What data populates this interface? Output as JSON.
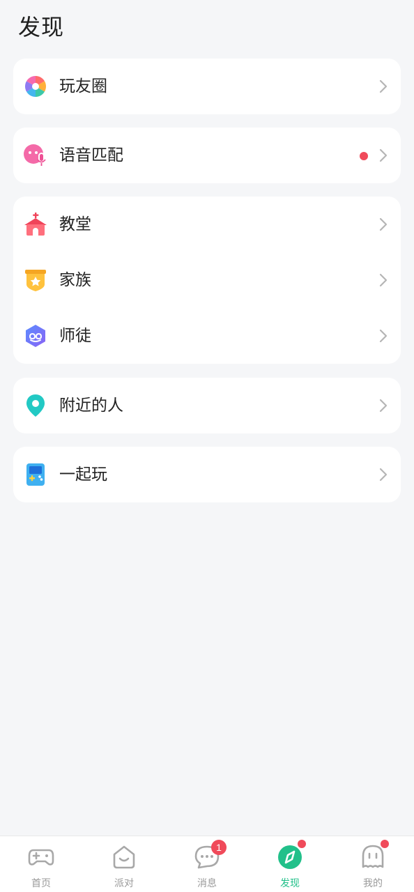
{
  "header": {
    "title": "发现"
  },
  "colors": {
    "accent": "#22c08a",
    "badge": "#f04a5a",
    "chevron": "#b5b5b5",
    "tab_inactive": "#9a9a9a"
  },
  "menu": {
    "moments": {
      "label": "玩友圈",
      "icon": "pinwheel-icon"
    },
    "voice_match": {
      "label": "语音匹配",
      "icon": "voice-match-icon",
      "has_dot": true
    },
    "church": {
      "label": "教堂",
      "icon": "church-icon"
    },
    "family": {
      "label": "家族",
      "icon": "family-badge-icon"
    },
    "mentor": {
      "label": "师徒",
      "icon": "mentor-icon"
    },
    "nearby": {
      "label": "附近的人",
      "icon": "location-pin-icon"
    },
    "play_together": {
      "label": "一起玩",
      "icon": "gameboy-icon"
    }
  },
  "tabbar": {
    "home": {
      "label": "首页",
      "icon": "gamepad-icon"
    },
    "party": {
      "label": "派对",
      "icon": "party-house-icon"
    },
    "messages": {
      "label": "消息",
      "icon": "chat-bubble-icon",
      "badge": "1"
    },
    "discover": {
      "label": "发现",
      "icon": "compass-icon",
      "active": true,
      "has_dot": true
    },
    "mine": {
      "label": "我的",
      "icon": "ghost-icon",
      "has_dot": true
    }
  }
}
